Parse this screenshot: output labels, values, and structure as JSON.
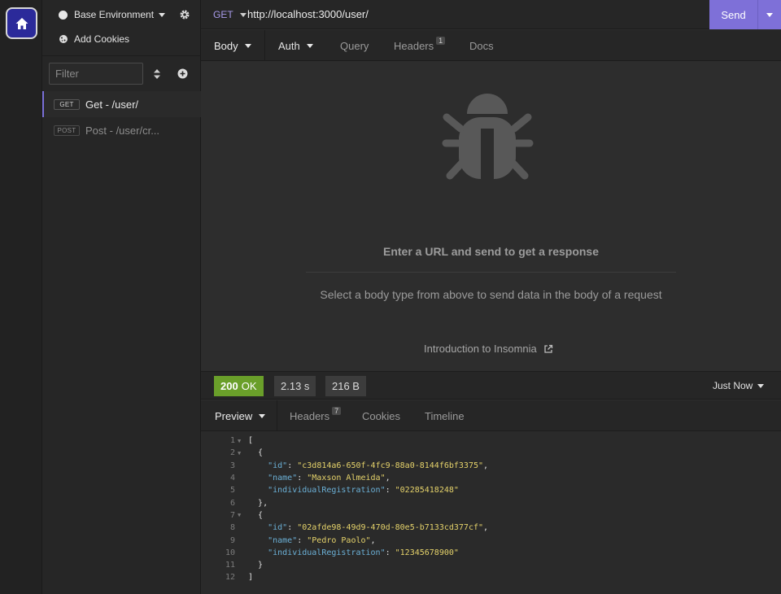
{
  "sidebar": {
    "environment": "Base Environment",
    "cookies_label": "Add Cookies",
    "filter_placeholder": "Filter",
    "requests": [
      {
        "method": "GET",
        "name": "Get - /user/"
      },
      {
        "method": "POST",
        "name": "Post - /user/cr..."
      }
    ]
  },
  "urlbar": {
    "method": "GET",
    "url": "http://localhost:3000/user/",
    "send_label": "Send"
  },
  "request_tabs": {
    "body": "Body",
    "auth": "Auth",
    "query": "Query",
    "headers": "Headers",
    "headers_count": "1",
    "docs": "Docs"
  },
  "request_empty": {
    "title": "Enter a URL and send to get a response",
    "subtitle": "Select a body type from above to send data in the body of a request",
    "intro_link": "Introduction to Insomnia"
  },
  "response": {
    "status_code": "200",
    "status_text": "OK",
    "time": "2.13 s",
    "size": "216 B",
    "when": "Just Now",
    "tabs": {
      "preview": "Preview",
      "headers": "Headers",
      "headers_count": "7",
      "cookies": "Cookies",
      "timeline": "Timeline"
    },
    "lines": [
      {
        "n": "1",
        "fold": true,
        "indent": "",
        "text": "["
      },
      {
        "n": "2",
        "fold": true,
        "indent": "  ",
        "text": "{"
      },
      {
        "n": "3",
        "fold": false,
        "indent": "    ",
        "key": "\"id\"",
        "sep": ": ",
        "val": "\"c3d814a6-650f-4fc9-88a0-8144f6bf3375\"",
        "tail": ","
      },
      {
        "n": "4",
        "fold": false,
        "indent": "    ",
        "key": "\"name\"",
        "sep": ": ",
        "val": "\"Maxson Almeida\"",
        "tail": ","
      },
      {
        "n": "5",
        "fold": false,
        "indent": "    ",
        "key": "\"individualRegistration\"",
        "sep": ": ",
        "val": "\"02285418248\"",
        "tail": ""
      },
      {
        "n": "6",
        "fold": false,
        "indent": "  ",
        "text": "},"
      },
      {
        "n": "7",
        "fold": true,
        "indent": "  ",
        "text": "{"
      },
      {
        "n": "8",
        "fold": false,
        "indent": "    ",
        "key": "\"id\"",
        "sep": ": ",
        "val": "\"02afde98-49d9-470d-80e5-b7133cd377cf\"",
        "tail": ","
      },
      {
        "n": "9",
        "fold": false,
        "indent": "    ",
        "key": "\"name\"",
        "sep": ": ",
        "val": "\"Pedro Paolo\"",
        "tail": ","
      },
      {
        "n": "10",
        "fold": false,
        "indent": "    ",
        "key": "\"individualRegistration\"",
        "sep": ": ",
        "val": "\"12345678900\"",
        "tail": ""
      },
      {
        "n": "11",
        "fold": false,
        "indent": "  ",
        "text": "}"
      },
      {
        "n": "12",
        "fold": false,
        "indent": "",
        "text": "]"
      }
    ]
  },
  "colors": {
    "accent": "#7e70d8",
    "status_ok": "#6a9f2a",
    "json_key": "#6bb0d6",
    "json_string": "#e5d26a"
  }
}
